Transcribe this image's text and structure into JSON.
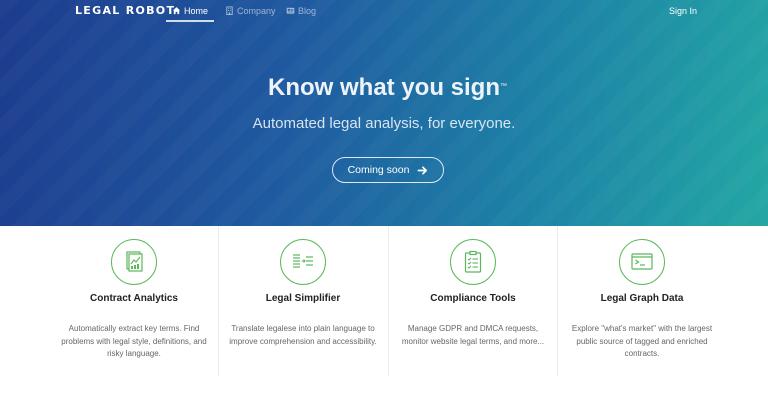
{
  "nav": {
    "logo": "LEGAL ROBOT",
    "links": [
      {
        "label": "Home",
        "icon": "home-icon",
        "active": true
      },
      {
        "label": "Company",
        "icon": "building-icon",
        "active": false
      },
      {
        "label": "Blog",
        "icon": "newspaper-icon",
        "active": false
      }
    ],
    "signin": "Sign In"
  },
  "hero": {
    "title": "Know what you sign",
    "trademark": "™",
    "subtitle": "Automated legal analysis, for everyone.",
    "cta": "Coming soon",
    "cta_icon": "arrow-right-icon"
  },
  "features": [
    {
      "title": "Contract Analytics",
      "icon": "contract-analytics-icon",
      "desc": "Automatically extract key terms. Find problems with legal style, definitions, and risky language."
    },
    {
      "title": "Legal Simplifier",
      "icon": "simplifier-icon",
      "desc": "Translate legalese into plain language to improve comprehension and accessibility."
    },
    {
      "title": "Compliance Tools",
      "icon": "clipboard-checklist-icon",
      "desc": "Manage GDPR and DMCA requests, monitor website legal terms, and more..."
    },
    {
      "title": "Legal Graph Data",
      "icon": "terminal-window-icon",
      "desc": "Explore \"what's market\" with the largest public source of tagged and enriched contracts."
    }
  ],
  "colors": {
    "hero_start": "#1d3c8e",
    "hero_end": "#23a7a4",
    "accent_green": "#5cb85c"
  }
}
